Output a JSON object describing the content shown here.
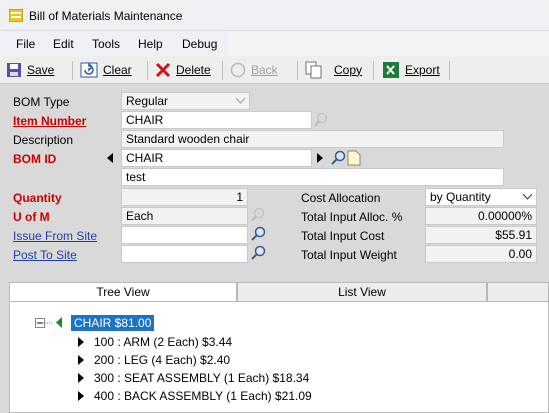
{
  "window": {
    "title": "Bill of Materials Maintenance"
  },
  "menu": [
    "File",
    "Edit",
    "Tools",
    "Help",
    "Debug"
  ],
  "toolbar": {
    "save": "Save",
    "clear": "Clear",
    "delete": "Delete",
    "back": "Back",
    "copy": "Copy",
    "export": "Export"
  },
  "form": {
    "bom_type_label": "BOM Type",
    "bom_type_value": "Regular",
    "item_number_label": "Item Number",
    "item_number_value": "CHAIR",
    "description_label": "Description",
    "description_value": "Standard wooden chair",
    "bom_id_label": "BOM ID",
    "bom_id_value": "CHAIR",
    "bom_id_desc": "test",
    "quantity_label": "Quantity",
    "quantity_value": "1",
    "uofm_label": "U of M",
    "uofm_value": "Each",
    "issue_site_label": "Issue From Site",
    "issue_site_value": "",
    "post_site_label": "Post To Site",
    "post_site_value": "",
    "cost_alloc_label": "Cost Allocation",
    "cost_alloc_value": "by Quantity",
    "total_input_alloc_label": "Total Input Alloc. %",
    "total_input_alloc_value": "0.00000%",
    "total_input_cost_label": "Total Input Cost",
    "total_input_cost_value": "$55.91",
    "total_input_weight_label": "Total Input  Weight",
    "total_input_weight_value": "0.00"
  },
  "tabs": [
    "Tree View",
    "List View"
  ],
  "tree": {
    "root": "CHAIR  $81.00",
    "children": [
      "100 : ARM (2 Each)  $3.44",
      "200 : LEG (4 Each)  $2.40",
      "300 : SEAT ASSEMBLY (1 Each)  $18.34",
      "400 : BACK ASSEMBLY (1 Each)  $21.09"
    ]
  },
  "colors": {
    "required": "#cc0000",
    "link": "#1f3fa6",
    "selection": "#1a73c8"
  }
}
